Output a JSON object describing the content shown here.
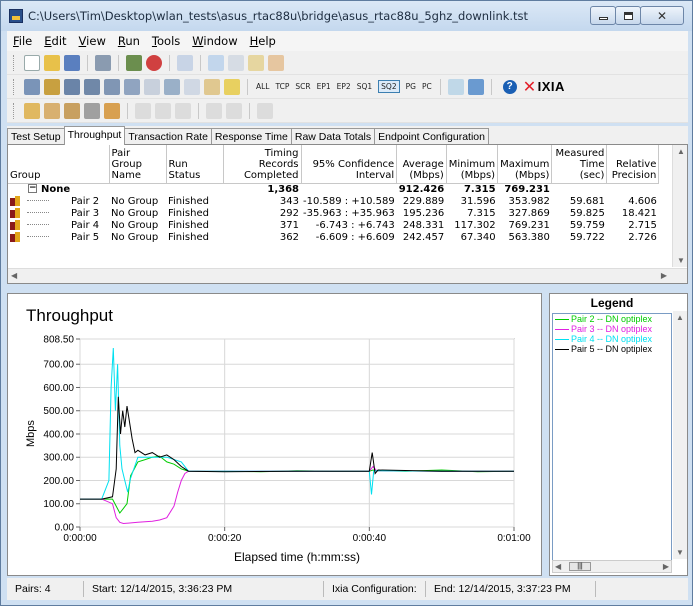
{
  "window": {
    "title": "C:\\Users\\Tim\\Desktop\\wlan_tests\\asus_rtac88u\\bridge\\asus_rtac88u_5ghz_downlink.tst"
  },
  "menu": [
    {
      "acc": "F",
      "rest": "ile"
    },
    {
      "acc": "E",
      "rest": "dit"
    },
    {
      "acc": "V",
      "rest": "iew"
    },
    {
      "acc": "R",
      "rest": "un"
    },
    {
      "acc": "T",
      "rest": "ools"
    },
    {
      "acc": "W",
      "rest": "indow"
    },
    {
      "acc": "H",
      "rest": "elp"
    }
  ],
  "toolbar2_labels": {
    "all": "ALL",
    "tcp": "TCP",
    "scr": "SCR",
    "ep1": "EP1",
    "ep2": "EP2",
    "sq1": "SQ1",
    "sq2": "SQ2",
    "pg": "PG",
    "pc": "PC",
    "brand": "IXIA",
    "help": "?"
  },
  "tabs": [
    "Test Setup",
    "Throughput",
    "Transaction Rate",
    "Response Time",
    "Raw Data Totals",
    "Endpoint Configuration"
  ],
  "grid": {
    "headers": {
      "group": "Group",
      "pair_group": "Pair Group Name",
      "run_status": "Run Status",
      "timing": "Timing Records Completed",
      "ci": "95% Confidence Interval",
      "avg": "Average (Mbps)",
      "min": "Minimum (Mbps)",
      "max": "Maximum (Mbps)",
      "time": "Measured Time (sec)",
      "prec": "Relative Precision"
    },
    "summary": {
      "label": "None",
      "timing": "1,368",
      "avg": "912.426",
      "min": "7.315",
      "max": "769.231"
    },
    "rows": [
      {
        "pair": "Pair 2",
        "group": "No Group",
        "status": "Finished",
        "timing": "343",
        "ci": "-10.589 : +10.589",
        "avg": "229.889",
        "min": "31.596",
        "max": "353.982",
        "time": "59.681",
        "prec": "4.606"
      },
      {
        "pair": "Pair 3",
        "group": "No Group",
        "status": "Finished",
        "timing": "292",
        "ci": "-35.963 : +35.963",
        "avg": "195.236",
        "min": "7.315",
        "max": "327.869",
        "time": "59.825",
        "prec": "18.421"
      },
      {
        "pair": "Pair 4",
        "group": "No Group",
        "status": "Finished",
        "timing": "371",
        "ci": "-6.743 : +6.743",
        "avg": "248.331",
        "min": "117.302",
        "max": "769.231",
        "time": "59.759",
        "prec": "2.715"
      },
      {
        "pair": "Pair 5",
        "group": "No Group",
        "status": "Finished",
        "timing": "362",
        "ci": "-6.609 : +6.609",
        "avg": "242.457",
        "min": "67.340",
        "max": "563.380",
        "time": "59.722",
        "prec": "2.726"
      }
    ]
  },
  "chart_data": {
    "type": "line",
    "title": "Throughput",
    "xlabel": "Elapsed time (h:mm:ss)",
    "ylabel": "Mbps",
    "ylim": [
      0,
      808.5
    ],
    "xlim": [
      0,
      60
    ],
    "yticks": [
      "0.00",
      "100.00",
      "200.00",
      "300.00",
      "400.00",
      "500.00",
      "600.00",
      "700.00",
      "808.50"
    ],
    "ytick_values": [
      0,
      100,
      200,
      300,
      400,
      500,
      600,
      700,
      808.5
    ],
    "xticks": [
      "0:00:00",
      "0:00:20",
      "0:00:40",
      "0:01:00"
    ],
    "xtick_values": [
      0,
      20,
      40,
      60
    ],
    "grid": true,
    "series": [
      {
        "name": "Pair 2 -- DN optiplex",
        "color": "#00cc00",
        "x": [
          0,
          3,
          4.5,
          5.5,
          6,
          6.5,
          7,
          7.5,
          8,
          9,
          10,
          11,
          12,
          13,
          14,
          15,
          20,
          25,
          30,
          35,
          40,
          40.5,
          41,
          45,
          50,
          55,
          60
        ],
        "y": [
          120,
          120,
          120,
          60,
          80,
          100,
          220,
          250,
          280,
          290,
          300,
          305,
          280,
          270,
          250,
          240,
          240,
          238,
          242,
          240,
          240,
          245,
          242,
          240,
          245,
          238,
          240
        ]
      },
      {
        "name": "Pair 3 -- DN optiplex",
        "color": "#e020e0",
        "x": [
          0,
          3,
          4.5,
          5,
          5.5,
          6,
          8,
          10,
          11,
          12,
          13,
          13.5,
          14,
          14.5,
          15,
          20,
          30,
          40,
          40.5,
          41,
          50,
          60
        ],
        "y": [
          120,
          120,
          100,
          40,
          20,
          15,
          20,
          25,
          30,
          40,
          90,
          150,
          200,
          230,
          240,
          240,
          240,
          240,
          260,
          242,
          240,
          240
        ]
      },
      {
        "name": "Pair 4 -- DN optiplex",
        "color": "#00e0f0",
        "x": [
          0,
          3,
          4,
          4.3,
          4.6,
          4.9,
          5.2,
          5.5,
          5.8,
          6.2,
          6.6,
          7,
          8,
          10,
          12,
          14,
          15,
          20,
          30,
          40,
          40.3,
          40.6,
          41,
          50,
          60
        ],
        "y": [
          120,
          120,
          200,
          600,
          770,
          500,
          700,
          350,
          250,
          200,
          150,
          210,
          300,
          300,
          300,
          280,
          240,
          240,
          240,
          240,
          140,
          240,
          242,
          240,
          240
        ]
      },
      {
        "name": "Pair 5 -- DN optiplex",
        "color": "#000000",
        "x": [
          0,
          3,
          4.5,
          5,
          5.3,
          5.6,
          5.9,
          6.2,
          6.5,
          6.8,
          7.2,
          7.6,
          8,
          9,
          10,
          11,
          12,
          13,
          14,
          15,
          20,
          30,
          40,
          40.4,
          40.8,
          41.2,
          50,
          60
        ],
        "y": [
          120,
          120,
          130,
          250,
          560,
          400,
          500,
          430,
          520,
          460,
          380,
          320,
          330,
          310,
          320,
          300,
          310,
          290,
          260,
          240,
          238,
          240,
          240,
          320,
          230,
          245,
          240,
          240
        ]
      }
    ]
  },
  "legend": {
    "title": "Legend"
  },
  "status": {
    "pairs": "Pairs: 4",
    "start": "Start: 12/14/2015, 3:36:23 PM",
    "ixia": "Ixia Configuration:",
    "end": "End: 12/14/2015, 3:37:23 PM"
  }
}
